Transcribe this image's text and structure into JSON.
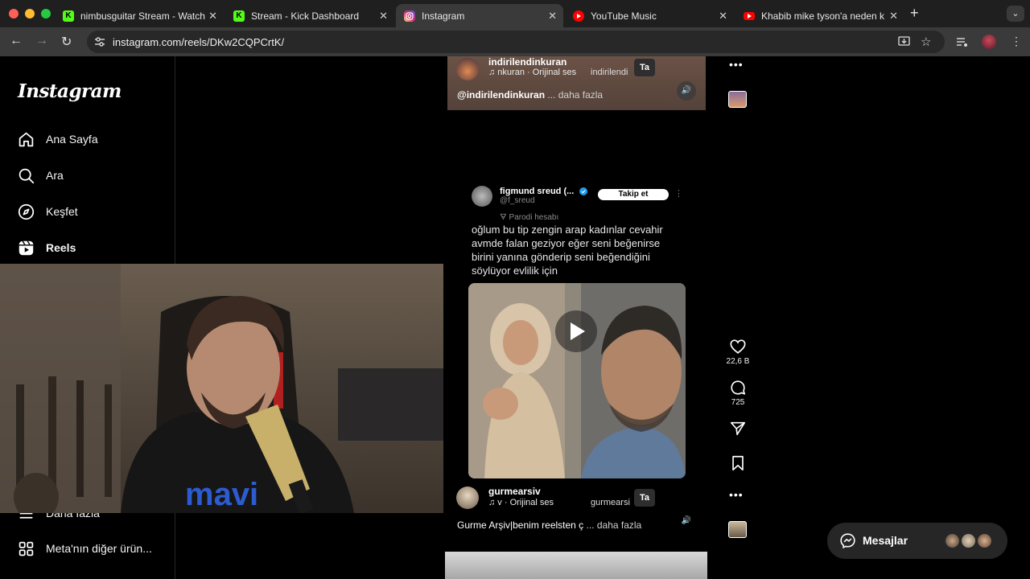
{
  "browser": {
    "tabs": [
      {
        "title": "nimbusguitar Stream - Watch",
        "favicon": "kick-icon",
        "color": "#53fc18"
      },
      {
        "title": "Stream - Kick Dashboard",
        "favicon": "kick-icon",
        "color": "#53fc18"
      },
      {
        "title": "Instagram",
        "favicon": "instagram-icon",
        "color": "#e1306c",
        "active": true
      },
      {
        "title": "YouTube Music",
        "favicon": "youtube-music-icon",
        "color": "#ff0000"
      },
      {
        "title": "Khabib mike tyson'a neden k",
        "favicon": "youtube-icon",
        "color": "#ff0000"
      }
    ],
    "url": "instagram.com/reels/DKw2CQPCrtK/"
  },
  "sidebar": {
    "logo": "Instagram",
    "items": [
      {
        "label": "Ana Sayfa",
        "icon": "home-icon"
      },
      {
        "label": "Ara",
        "icon": "search-icon"
      },
      {
        "label": "Keşfet",
        "icon": "compass-icon"
      },
      {
        "label": "Reels",
        "icon": "reels-icon"
      },
      {
        "label": "Daha fazla",
        "icon": "menu-icon"
      },
      {
        "label": "Meta'nın diğer ürün...",
        "icon": "meta-apps-icon"
      }
    ]
  },
  "reel_top": {
    "username": "indirilendinkuran",
    "audio": "♫ nkuran · Orijinal ses",
    "audio_right": "indirilendi",
    "follow_chip": "Ta",
    "caption_user": "@indirilendinkuran",
    "caption_more": "... daha fazla"
  },
  "reel_main": {
    "tweet_name": "figmund sreud (...",
    "tweet_handle": "@f_sreud",
    "tweet_parody": "Parodi hesabı",
    "tweet_follow": "Takip et",
    "tweet_text": "oğlum bu tip zengin arap kadınlar cevahir avmde falan geziyor eğer seni beğenirse birini yanına gönderip seni beğendiğini söylüyor evlilik için",
    "username": "gurmearsiv",
    "audio": "♫ v · Orijinal ses",
    "audio_right": "gurmearsi",
    "follow_chip": "Ta",
    "caption": "Gurme Arşiv|benim reelsten ç",
    "caption_more": "... daha fazla",
    "likes": "22,6 B",
    "comments": "725"
  },
  "messages": {
    "label": "Mesajlar"
  }
}
